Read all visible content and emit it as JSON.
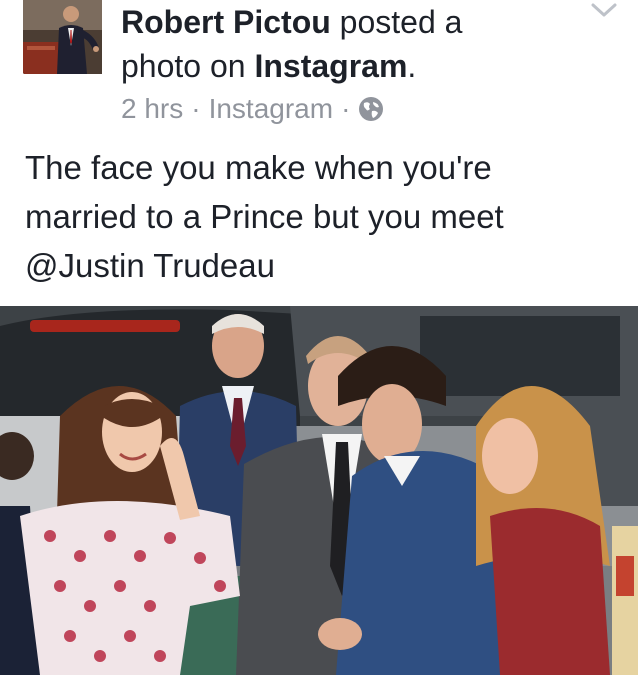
{
  "post": {
    "author": "Robert Pictou",
    "action_prefix": "posted a",
    "action_line2_prefix": "photo on",
    "platform": "Instagram",
    "period": ".",
    "timestamp": "2 hrs",
    "separator": "·",
    "source": "Instagram",
    "privacy_icon": "globe-icon",
    "menu_icon": "chevron-down-icon",
    "text_line1": "The face you make when you're",
    "text_line2": "married to a Prince but you meet",
    "text_line3": "@Justin Trudeau"
  },
  "colors": {
    "text": "#1d2129",
    "meta": "#90949c",
    "background": "#ffffff"
  }
}
